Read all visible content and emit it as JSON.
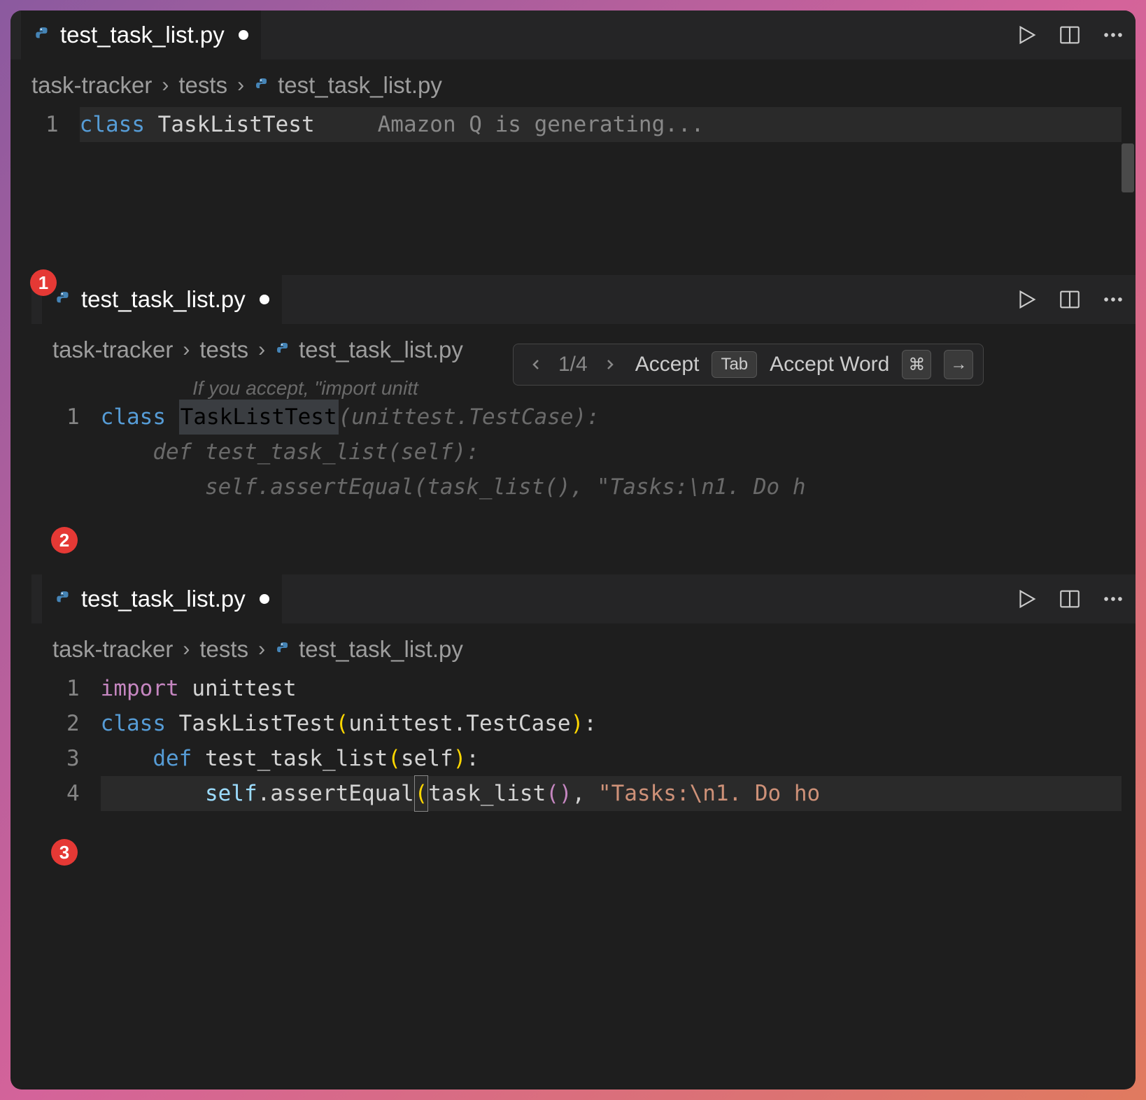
{
  "panels": [
    {
      "tab_title": "test_task_list.py",
      "breadcrumb": {
        "root": "task-tracker",
        "folder": "tests",
        "file": "test_task_list.py"
      },
      "badge": "1",
      "code": {
        "line1_num": "1",
        "line1_keyword": "class",
        "line1_name": "TaskListTest",
        "generating": "Amazon Q is generating..."
      }
    },
    {
      "tab_title": "test_task_list.py",
      "breadcrumb": {
        "root": "task-tracker",
        "folder": "tests",
        "file": "test_task_list.py"
      },
      "badge": "2",
      "popup": {
        "counter": "1/4",
        "accept": "Accept",
        "accept_key": "Tab",
        "accept_word": "Accept Word",
        "cmd_key": "⌘",
        "arrow_key": "→"
      },
      "hint": "If you accept, \"import unitt",
      "code": {
        "line1_num": "1",
        "line1_keyword": "class",
        "line1_name": "TaskListTest",
        "line1_ghost": "(unittest.TestCase):",
        "line2_ghost": "    def test_task_list(self):",
        "line3_ghost": "        self.assertEqual(task_list(), \"Tasks:\\n1. Do h"
      }
    },
    {
      "tab_title": "test_task_list.py",
      "breadcrumb": {
        "root": "task-tracker",
        "folder": "tests",
        "file": "test_task_list.py"
      },
      "badge": "3",
      "code": {
        "line1_num": "1",
        "line1_import": "import",
        "line1_module": "unittest",
        "line2_num": "2",
        "line2_keyword": "class",
        "line2_name": "TaskListTest",
        "line2_base": "unittest.TestCase",
        "line3_num": "3",
        "line3_def": "def",
        "line3_func": "test_task_list",
        "line3_param": "self",
        "line4_num": "4",
        "line4_self": "self",
        "line4_method": ".assertEqual",
        "line4_call": "task_list",
        "line4_string": "\"Tasks:\\n1. Do ho"
      }
    }
  ]
}
